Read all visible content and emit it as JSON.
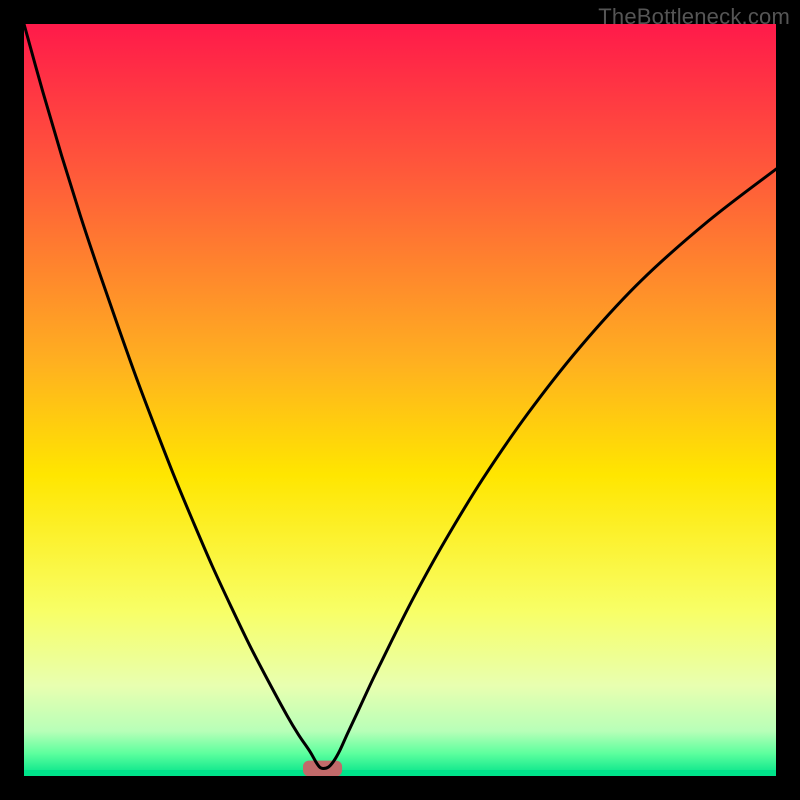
{
  "watermark": "TheBottleneck.com",
  "chart_data": {
    "type": "line",
    "title": "",
    "xlabel": "",
    "ylabel": "",
    "xlim": [
      0,
      100
    ],
    "ylim": [
      0,
      100
    ],
    "gradient_stops": [
      {
        "offset": 0.0,
        "color": "#ff1a4a"
      },
      {
        "offset": 0.2,
        "color": "#ff5a3a"
      },
      {
        "offset": 0.45,
        "color": "#ffb020"
      },
      {
        "offset": 0.6,
        "color": "#ffe600"
      },
      {
        "offset": 0.78,
        "color": "#f8ff66"
      },
      {
        "offset": 0.88,
        "color": "#e8ffb0"
      },
      {
        "offset": 0.94,
        "color": "#b8ffb8"
      },
      {
        "offset": 0.97,
        "color": "#5dff9e"
      },
      {
        "offset": 1.0,
        "color": "#00e38a"
      }
    ],
    "series": [
      {
        "name": "bottleneck-curve",
        "x": [
          0.0,
          2.5,
          5.0,
          7.5,
          10.0,
          12.5,
          15.0,
          17.5,
          20.0,
          22.5,
          25.0,
          27.5,
          30.0,
          32.5,
          35.0,
          36.5,
          38.0,
          38.8,
          39.3,
          39.8,
          40.5,
          41.2,
          42.0,
          43.0,
          44.5,
          46.5,
          49.0,
          52.0,
          56.0,
          61.0,
          67.0,
          74.0,
          82.0,
          91.0,
          100.0
        ],
        "y": [
          100.0,
          91.0,
          82.5,
          74.5,
          67.0,
          59.8,
          52.8,
          46.2,
          39.8,
          33.8,
          28.0,
          22.6,
          17.4,
          12.6,
          8.0,
          5.5,
          3.3,
          1.9,
          1.2,
          1.0,
          1.2,
          2.0,
          3.4,
          5.6,
          8.8,
          13.1,
          18.2,
          24.1,
          31.3,
          39.5,
          48.2,
          57.1,
          65.8,
          73.8,
          80.7
        ]
      }
    ],
    "marker": {
      "name": "optimal-band",
      "x_center": 39.7,
      "x_halfwidth": 2.6,
      "y": 1.0,
      "height": 2.1,
      "color": "#c26a6a"
    }
  }
}
